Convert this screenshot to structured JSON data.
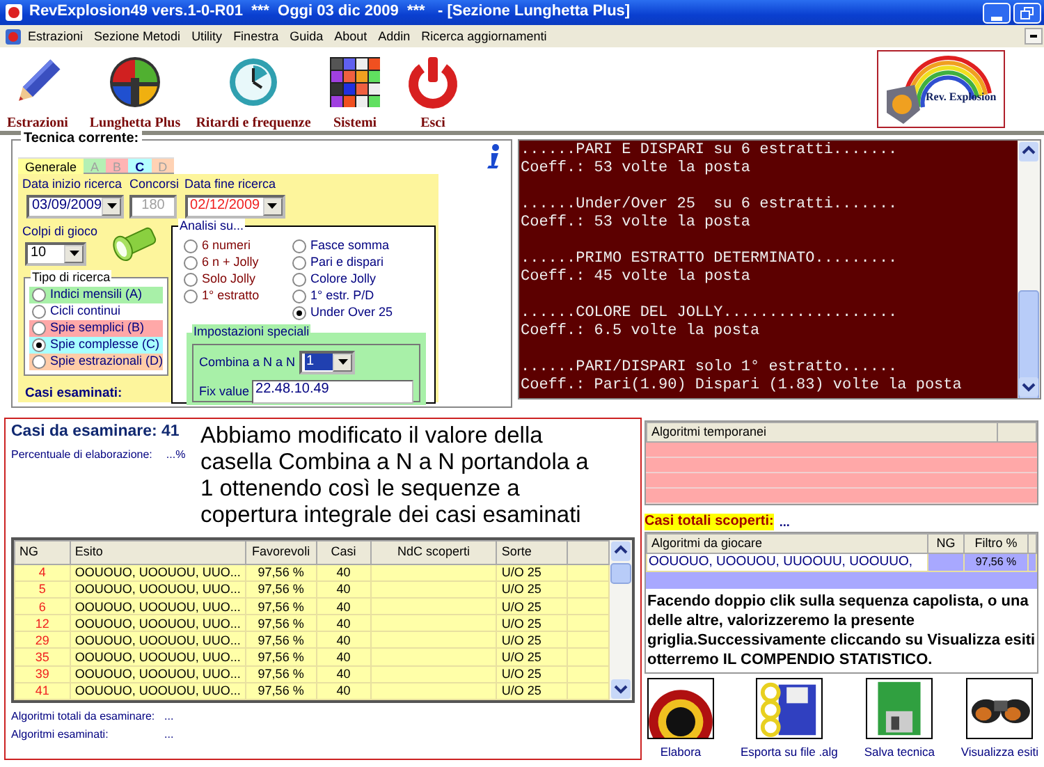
{
  "window": {
    "title": "RevExplosion49 vers.1-0-R01  ***  Oggi 03 dic 2009  ***   - [Sezione Lunghetta Plus]"
  },
  "menu": [
    "Estrazioni",
    "Sezione Metodi",
    "Utility",
    "Finestra",
    "Guida",
    "About",
    "Addin",
    "Ricerca aggiornamenti"
  ],
  "toolbar": [
    {
      "label": "Estrazioni",
      "kind": "pencil"
    },
    {
      "label": "Lunghetta Plus",
      "kind": "quad"
    },
    {
      "label": "Ritardi e frequenze",
      "kind": "clock"
    },
    {
      "label": "Sistemi",
      "kind": "grid"
    },
    {
      "label": "Esci",
      "kind": "power"
    }
  ],
  "logo": {
    "text": "Rev. Explosion"
  },
  "tecnica": {
    "title": "Tecnica corrente:",
    "tabs": [
      {
        "label": "Generale",
        "selected": true,
        "disabled": false,
        "color": "#ffff99"
      },
      {
        "label": "A",
        "selected": false,
        "disabled": true,
        "color": "#b4f0b4"
      },
      {
        "label": "B",
        "selected": false,
        "disabled": true,
        "color": "#ffb4b4"
      },
      {
        "label": "C",
        "selected": false,
        "disabled": false,
        "color": "#b4ffff"
      },
      {
        "label": "D",
        "selected": false,
        "disabled": true,
        "color": "#ffd2b4"
      }
    ],
    "data_inizio": {
      "label": "Data inizio ricerca",
      "value": "03/09/2009"
    },
    "concorsi": {
      "label": "Concorsi",
      "value": "180",
      "disabled": true
    },
    "data_fine": {
      "label": "Data fine ricerca",
      "value": "02/12/2009"
    },
    "colpi": {
      "label": "Colpi di gioco",
      "value": "10"
    },
    "tipo": {
      "title": "Tipo di ricerca",
      "options": [
        {
          "label": "Indici mensili (A)",
          "selected": false,
          "color": "#a8f0a8"
        },
        {
          "label": "Cicli continui",
          "selected": false,
          "color": "#ffffff"
        },
        {
          "label": "Spie semplici (B)",
          "selected": false,
          "color": "#ffa8a8"
        },
        {
          "label": "Spie complesse (C)",
          "selected": true,
          "color": "#a8ffff"
        },
        {
          "label": "Spie estrazionali (D)",
          "selected": false,
          "color": "#ffcca8"
        }
      ]
    },
    "analisi": {
      "title": "Analisi su...",
      "options": [
        {
          "label": "6 numeri",
          "selected": false,
          "color": "#800000"
        },
        {
          "label": "6 n + Jolly",
          "selected": false,
          "color": "#800000"
        },
        {
          "label": "Solo Jolly",
          "selected": false,
          "color": "#800000"
        },
        {
          "label": "1° estratto",
          "selected": false,
          "color": "#800000"
        },
        {
          "label": "Fasce somma",
          "selected": false,
          "color": "#000080"
        },
        {
          "label": "Pari e dispari",
          "selected": false,
          "color": "#000080"
        },
        {
          "label": "Colore Jolly",
          "selected": false,
          "color": "#000080"
        },
        {
          "label": "1° estr. P/D",
          "selected": false,
          "color": "#000080"
        },
        {
          "label": "Under Over 25",
          "selected": true,
          "color": "#000080"
        }
      ]
    },
    "impostazioni": {
      "title": "Impostazioni speciali",
      "combina": {
        "label": "Combina a N a N",
        "value": "1"
      },
      "fix": {
        "label": "Fix value",
        "value": "22.48.10.49"
      }
    },
    "casi_esaminati": "Casi esaminati:"
  },
  "console": [
    {
      "heading": "......PARI E DISPARI su 6 estratti.......",
      "coeff": "Coeff.: 53 volte la posta"
    },
    {
      "heading": "......Under/Over 25  su 6 estratti.......",
      "coeff": "Coeff.: 53 volte la posta"
    },
    {
      "heading": "......PRIMO ESTRATTO DETERMINATO.........",
      "coeff": "Coeff.: 45 volte la posta"
    },
    {
      "heading": "......COLORE DEL JOLLY...................",
      "coeff": "Coeff.: 6.5 volte la posta"
    },
    {
      "heading": "......PARI/DISPARI solo 1° estratto......",
      "coeff": "Coeff.: Pari(1.90) Dispari (1.83) volte la posta"
    }
  ],
  "esame": {
    "casi": {
      "label": "Casi da esaminare:",
      "value": "41"
    },
    "percentuale": {
      "label": "Percentuale di elaborazione:",
      "value": "...%"
    },
    "note": "Abbiamo modificato il valore della casella Combina a N a N portandola a 1 ottenendo così le sequenze a copertura integrale dei casi esaminati",
    "table": {
      "columns": [
        "NG",
        "Esito",
        "Favorevoli",
        "Casi",
        "NdC scoperti",
        "Sorte"
      ],
      "rows": [
        [
          "4",
          "OOUOUO, UOOUOU, UUO...",
          "97,56 %",
          "40",
          "",
          "U/O 25"
        ],
        [
          "5",
          "OOUOUO, UOOUOU, UUO...",
          "97,56 %",
          "40",
          "",
          "U/O 25"
        ],
        [
          "6",
          "OOUOUO, UOOUOU, UUO...",
          "97,56 %",
          "40",
          "",
          "U/O 25"
        ],
        [
          "12",
          "OOUOUO, UOOUOU, UUO...",
          "97,56 %",
          "40",
          "",
          "U/O 25"
        ],
        [
          "29",
          "OOUOUO, UOOUOU, UUO...",
          "97,56 %",
          "40",
          "",
          "U/O 25"
        ],
        [
          "35",
          "OOUOUO, UOOUOU, UUO...",
          "97,56 %",
          "40",
          "",
          "U/O 25"
        ],
        [
          "39",
          "OOUOUO, UOOUOU, UUO...",
          "97,56 %",
          "40",
          "",
          "U/O 25"
        ],
        [
          "41",
          "OOUOUO, UOOUOU, UUO...",
          "97,56 %",
          "40",
          "",
          "U/O 25"
        ]
      ]
    },
    "totali": {
      "label": "Algoritmi totali da esaminare:",
      "value": "..."
    },
    "esaminati": {
      "label": "Algoritmi esaminati:",
      "value": "..."
    }
  },
  "temporanei": {
    "columns": [
      "Algoritmi temporanei"
    ]
  },
  "casi_totali": {
    "label": "Casi totali scoperti:",
    "value": "..."
  },
  "da_giocare": {
    "columns": [
      "Algoritmi da giocare",
      "NG",
      "Filtro %"
    ],
    "rows": [
      {
        "algoritmi": "OOUOUO, UOOUOU, UUOOUU, UOOUUO,",
        "filtro": "97,56 %"
      }
    ]
  },
  "note2": "Facendo doppio clik sulla sequenza capolista, o una delle altre, valorizzeremo la presente griglia.Successivamente cliccando su Visualizza esiti otterremo IL COMPENDIO STATISTICO.",
  "actions": [
    {
      "label": "Elabora",
      "kind": "target"
    },
    {
      "label": "Esporta su file .alg",
      "kind": "disk-rings"
    },
    {
      "label": "Salva tecnica",
      "kind": "disk"
    },
    {
      "label": "Visualizza esiti",
      "kind": "binoculars"
    }
  ]
}
